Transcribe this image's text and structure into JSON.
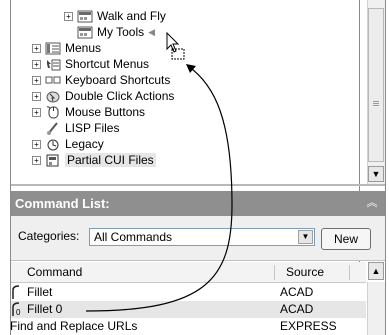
{
  "tree": {
    "items": [
      {
        "label": "Walk and Fly",
        "expander": "+",
        "icon": "toolbar-icon"
      },
      {
        "label": "My Tools",
        "expander": "",
        "icon": "toolbar-icon"
      },
      {
        "label": "Menus",
        "expander": "+",
        "icon": "menu-icon"
      },
      {
        "label": "Shortcut Menus",
        "expander": "+",
        "icon": "shortcut-menu-icon"
      },
      {
        "label": "Keyboard Shortcuts",
        "expander": "+",
        "icon": "keyboard-icon"
      },
      {
        "label": "Double Click Actions",
        "expander": "+",
        "icon": "double-click-icon"
      },
      {
        "label": "Mouse Buttons",
        "expander": "+",
        "icon": "mouse-icon"
      },
      {
        "label": "LISP Files",
        "expander": "",
        "icon": "lisp-file-icon"
      },
      {
        "label": "Legacy",
        "expander": "+",
        "icon": "legacy-icon"
      },
      {
        "label": "Partial CUI Files",
        "expander": "+",
        "icon": "partial-cui-icon"
      }
    ]
  },
  "command_list": {
    "title": "Command List:",
    "categories_label": "Categories:",
    "categories_value": "All Commands",
    "new_button": "New",
    "columns": {
      "command": "Command",
      "source": "Source"
    },
    "rows": [
      {
        "command": "Fillet",
        "source": "ACAD"
      },
      {
        "command": "Fillet 0",
        "source": "ACAD"
      },
      {
        "command": "Find and Replace URLs",
        "source": "EXPRESS"
      }
    ]
  },
  "colors": {
    "header_bg": "#8f8f8f",
    "selection": "#e6e6e6",
    "panel_bg": "#efefef"
  }
}
